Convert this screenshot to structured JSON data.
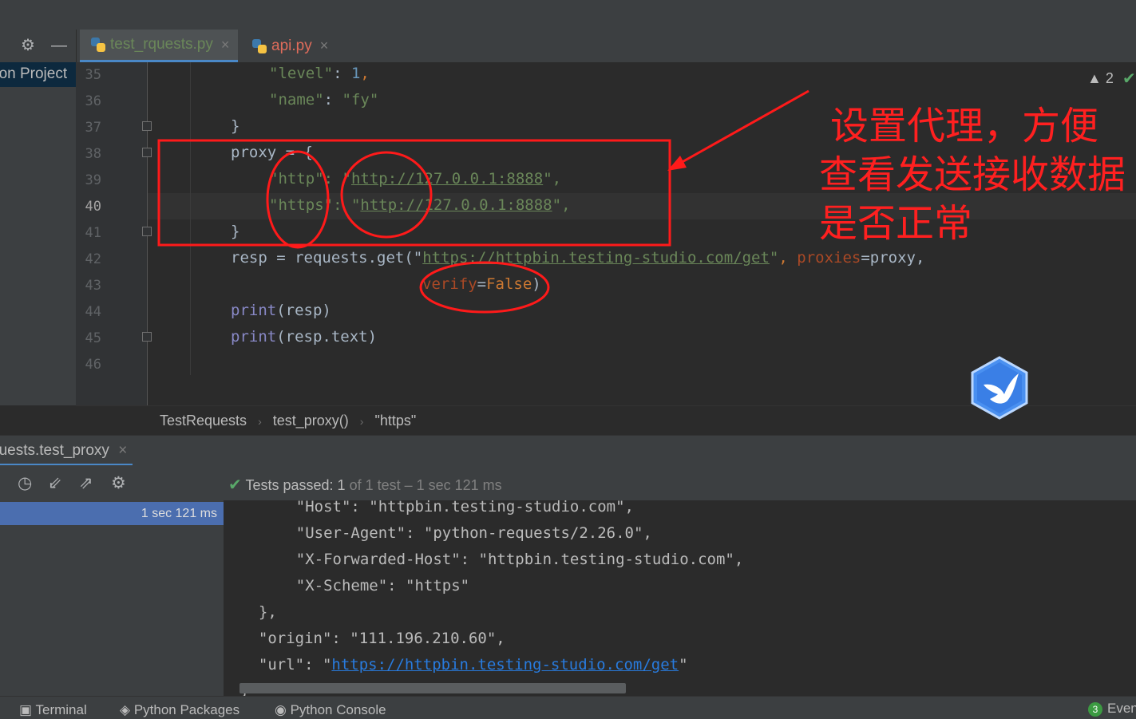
{
  "toolbar": {
    "settings_icon": "gear-icon",
    "hide_icon": "minus-icon"
  },
  "tabs": [
    {
      "label": "test_rquests.py",
      "color": "#6a8759",
      "active": true
    },
    {
      "label": "api.py",
      "color": "#e06c5b",
      "active": false
    }
  ],
  "project": {
    "label": "hon Project"
  },
  "editor": {
    "line_numbers": [
      "35",
      "36",
      "37",
      "38",
      "39",
      "40",
      "41",
      "42",
      "43",
      "44",
      "45",
      "46"
    ],
    "current_line": "40",
    "inspections": {
      "warnings": "2"
    }
  },
  "code": {
    "l35_key": "\"level\"",
    "l35_colon": ": ",
    "l35_val": "1",
    "l35_comma": ",",
    "l36_key": "\"name\"",
    "l36_colon": ": ",
    "l36_val": "\"fy\"",
    "l37": "}",
    "l38_var": "proxy",
    "l38_rest": " = {",
    "l39_key": "\"http\"",
    "l39_colon": ": \"",
    "l39_url": "http://127.0.0.1:8888",
    "l39_end": "\",",
    "l40_key": "\"https\"",
    "l40_colon": ": \"",
    "l40_url": "http://127.0.0.1:8888",
    "l40_end": "\",",
    "l41": "}",
    "l42_a": "resp = requests.get(\"",
    "l42_url": "https://httpbin.testing-studio.com/get",
    "l42_b": "\"",
    "l42_comma": ", ",
    "l42_kw": "proxies",
    "l42_c": "=proxy,",
    "l43_kw": "verify",
    "l43_eq": "=",
    "l43_val": "False",
    "l43_end": ")",
    "l44_fn": "print",
    "l44_rest": "(resp)",
    "l45_fn": "print",
    "l45_rest": "(resp.text)"
  },
  "breadcrumb": [
    "TestRequests",
    "test_proxy()",
    "\"https\""
  ],
  "run": {
    "tab_label": "quests.test_proxy",
    "tests_passed": "Tests passed:",
    "passed_count": "1",
    "passed_detail": "of 1 test – 1 sec 121 ms",
    "tree_time": "1 sec 121 ms",
    "console_lines": [
      "    \"Host\": \"httpbin.testing-studio.com\",",
      "    \"User-Agent\": \"python-requests/2.26.0\",",
      "    \"X-Forwarded-Host\": \"httpbin.testing-studio.com\",",
      "    \"X-Scheme\": \"https\"",
      "  },",
      "  \"origin\": \"111.196.210.60\","
    ],
    "url_prefix": "  \"url\": \"",
    "url_link": "https://httpbin.testing-studio.com/get",
    "url_suffix": "\"",
    "last_line": "}"
  },
  "statusbar": {
    "terminal": "Terminal",
    "packages": "Python Packages",
    "console": "Python Console",
    "events_count": "3",
    "events": "Even"
  },
  "annotation": {
    "line1": "设置代理，方便",
    "line2": "查看发送接收数据",
    "line3": "是否正常",
    "color": "#ff2020"
  }
}
